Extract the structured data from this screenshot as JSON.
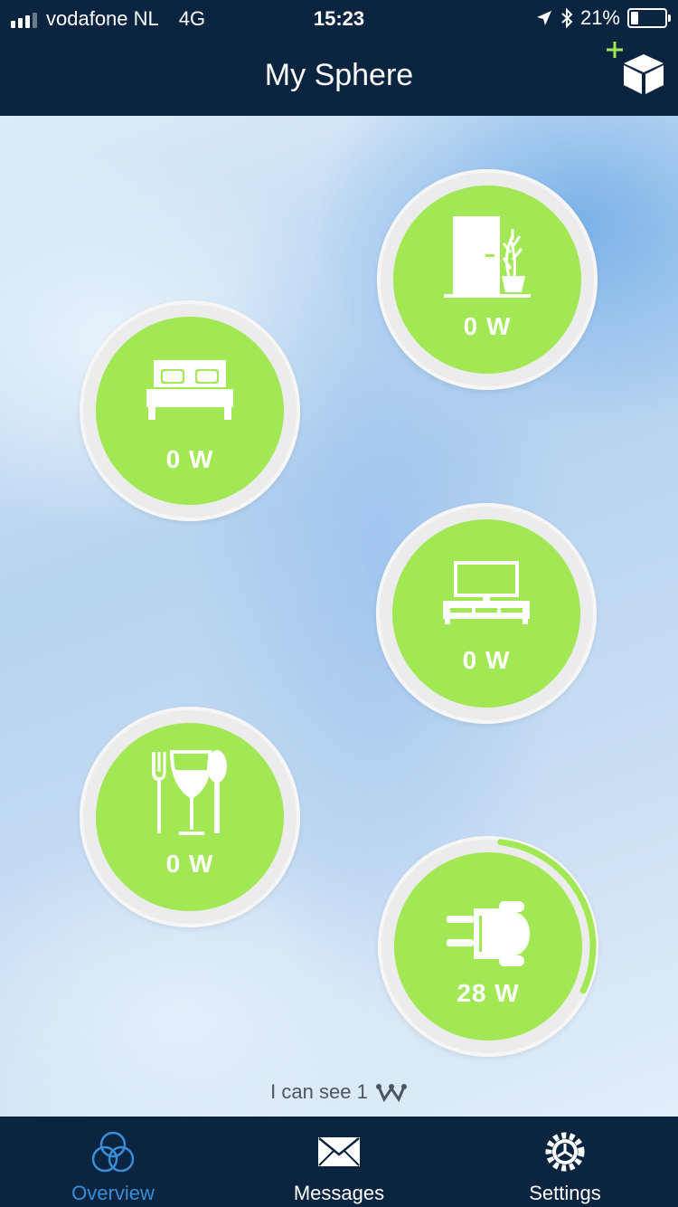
{
  "status_bar": {
    "carrier": "vodafone NL",
    "network": "4G",
    "time": "15:23",
    "battery": "21%",
    "battery_level": 0.21,
    "icons": [
      "signal-icon",
      "location-arrow-icon",
      "bluetooth-icon",
      "battery-icon"
    ]
  },
  "header": {
    "title": "My Sphere",
    "add_icon": "add-sphere-icon",
    "accent_color": "#a2e855"
  },
  "rooms": [
    {
      "icon": "living-room-icon",
      "power": "0 W",
      "usage_fraction": 0
    },
    {
      "icon": "bedroom-icon",
      "power": "0 W",
      "usage_fraction": 0
    },
    {
      "icon": "tv-room-icon",
      "power": "0 W",
      "usage_fraction": 0
    },
    {
      "icon": "dining-icon",
      "power": "0 W",
      "usage_fraction": 0
    },
    {
      "icon": "plug-icon",
      "power": "28 W",
      "usage_fraction": 0.3
    }
  ],
  "presence": {
    "text": "I can see 1",
    "icon": "crownstone-icon"
  },
  "tabbar": {
    "tabs": [
      {
        "label": "Overview",
        "icon": "overview-icon",
        "active": true
      },
      {
        "label": "Messages",
        "icon": "messages-icon",
        "active": false
      },
      {
        "label": "Settings",
        "icon": "settings-icon",
        "active": false
      }
    ]
  },
  "colors": {
    "header_bg": "#0b2440",
    "room_green": "#a2e855",
    "active_tab": "#3a8ed8"
  }
}
